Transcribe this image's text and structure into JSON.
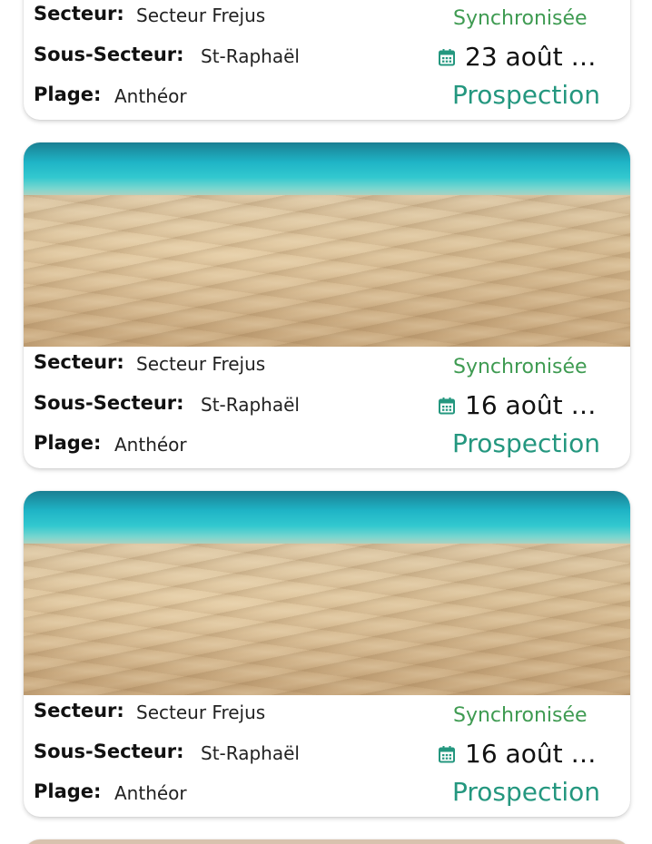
{
  "labels": {
    "secteur": "Secteur:",
    "sous_secteur": "Sous-Secteur:",
    "plage": "Plage:"
  },
  "colors": {
    "sync_status": "#3f9b52",
    "activity_type": "#24977f",
    "calendar_icon": "#24977f"
  },
  "cards": [
    {
      "secteur": "Secteur Frejus",
      "sous_secteur": "St-Raphaël",
      "plage": "Anthéor",
      "status": "Synchronisée",
      "date": "23 août 2...",
      "type": "Prospection",
      "has_photo": false
    },
    {
      "secteur": "Secteur Frejus",
      "sous_secteur": "St-Raphaël",
      "plage": "Anthéor",
      "status": "Synchronisée",
      "date": "16 août 2...",
      "type": "Prospection",
      "has_photo": true
    },
    {
      "secteur": "Secteur Frejus",
      "sous_secteur": "St-Raphaël",
      "plage": "Anthéor",
      "status": "Synchronisée",
      "date": "16 août 2...",
      "type": "Prospection",
      "has_photo": true
    }
  ],
  "icons": {
    "date": "calendar-icon",
    "photo": "beach-sand-photo"
  }
}
